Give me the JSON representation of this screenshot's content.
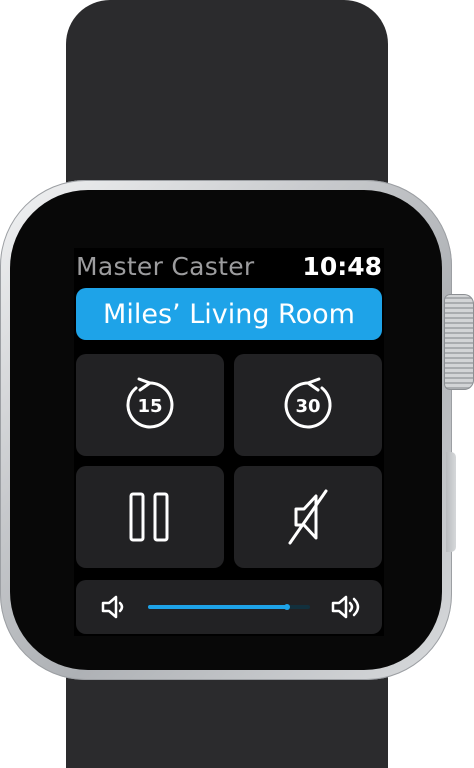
{
  "app": {
    "title": "Master Caster",
    "time": "10:48"
  },
  "device": {
    "name": "Miles’ Living Room"
  },
  "controls": {
    "rewind": {
      "icon": "rewind-15-icon",
      "seconds": "15"
    },
    "forward": {
      "icon": "forward-30-icon",
      "seconds": "30"
    },
    "pause": {
      "icon": "pause-icon"
    },
    "mute": {
      "icon": "mute-icon"
    }
  },
  "volume": {
    "level": 0.86,
    "down_icon": "volume-down-icon",
    "up_icon": "volume-up-icon",
    "accent": "#1ea3e8"
  },
  "colors": {
    "accent": "#1ea3e8",
    "tile": "#222224",
    "title_text": "#9c9c9e"
  }
}
